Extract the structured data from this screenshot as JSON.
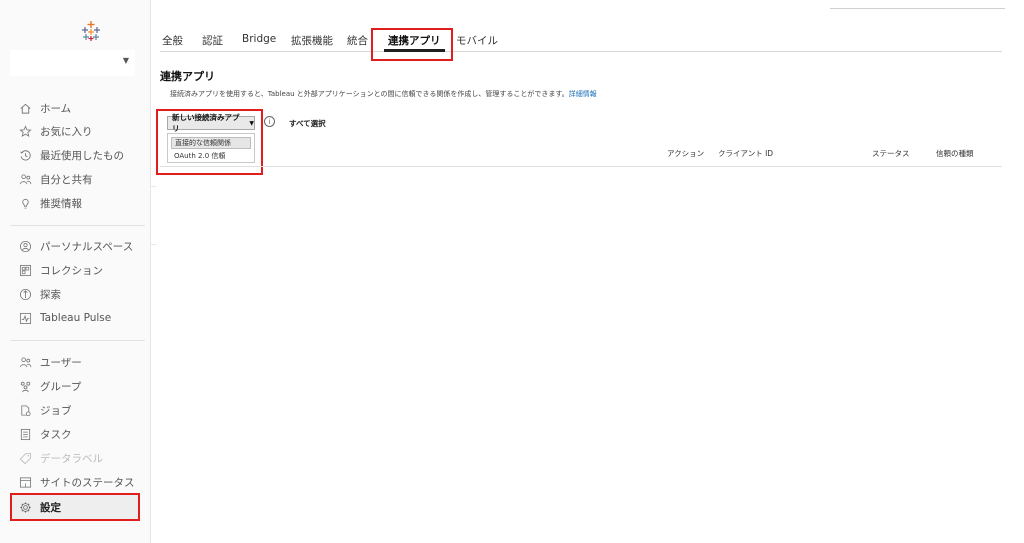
{
  "sidebar": {
    "nav_primary": [
      {
        "label": "ホーム",
        "icon": "home-icon"
      },
      {
        "label": "お気に入り",
        "icon": "star-icon"
      },
      {
        "label": "最近使用したもの",
        "icon": "history-icon"
      },
      {
        "label": "自分と共有",
        "icon": "shared-users-icon"
      },
      {
        "label": "推奨情報",
        "icon": "lightbulb-icon"
      }
    ],
    "nav_content": [
      {
        "label": "パーソナルスペース",
        "icon": "person-icon"
      },
      {
        "label": "コレクション",
        "icon": "collection-icon"
      },
      {
        "label": "探索",
        "icon": "explore-icon"
      },
      {
        "label": "Tableau Pulse",
        "icon": "pulse-icon"
      }
    ],
    "nav_admin": [
      {
        "label": "ユーザー",
        "icon": "user-icon"
      },
      {
        "label": "グループ",
        "icon": "group-icon"
      },
      {
        "label": "ジョブ",
        "icon": "jobs-icon"
      },
      {
        "label": "タスク",
        "icon": "tasks-icon"
      },
      {
        "label": "データラベル",
        "icon": "tag-icon"
      },
      {
        "label": "サイトのステータス",
        "icon": "status-icon"
      },
      {
        "label": "設定",
        "icon": "gear-icon"
      }
    ]
  },
  "tabs": [
    {
      "label": "全般"
    },
    {
      "label": "認証"
    },
    {
      "label": "Bridge"
    },
    {
      "label": "拡張機能"
    },
    {
      "label": "統合"
    },
    {
      "label": "連携アプリ"
    },
    {
      "label": "モバイル"
    }
  ],
  "page": {
    "title": "連携アプリ",
    "description": "接続済みアプリを使用すると、Tableau と外部アプリケーションとの間に信頼できる関係を作成し、管理することができます。",
    "learn_more": "詳細情報"
  },
  "toolbar": {
    "new_app_label": "新しい接続済みアプリ",
    "select_all_label": "すべて選択"
  },
  "new_app_menu": [
    {
      "label": "直接的な信頼関係"
    },
    {
      "label": "OAuth 2.0 信頼"
    }
  ],
  "table": {
    "columns": [
      "アクション",
      "クライアント ID",
      "ステータス",
      "信頼の種類"
    ]
  },
  "colors": {
    "highlight": "#e11d1d",
    "link": "#1a6fb8"
  }
}
